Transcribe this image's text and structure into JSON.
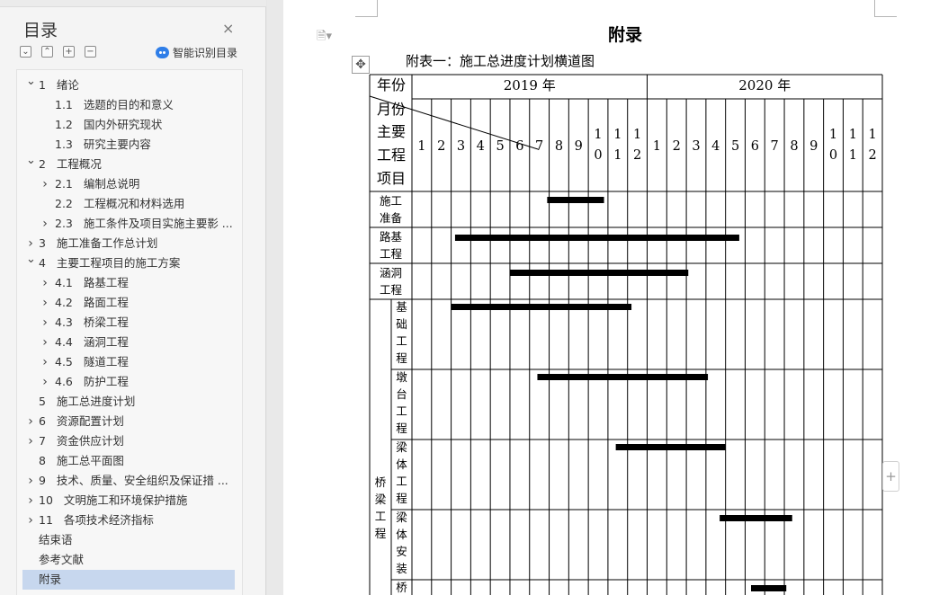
{
  "sidebar": {
    "title": "目录",
    "close_glyph": "×",
    "tools": [
      {
        "icon": "collapse-all-icon",
        "glyph": "⌄"
      },
      {
        "icon": "expand-all-icon",
        "glyph": "⌃"
      },
      {
        "icon": "add-heading-icon",
        "glyph": "+"
      },
      {
        "icon": "remove-heading-icon",
        "glyph": "−"
      }
    ],
    "smart_label": "智能识别目录",
    "items": [
      {
        "level": 0,
        "chevron": "down",
        "num": "1",
        "label": "绪论"
      },
      {
        "level": 1,
        "chevron": "",
        "num": "1.1",
        "label": "选题的目的和意义"
      },
      {
        "level": 1,
        "chevron": "",
        "num": "1.2",
        "label": "国内外研究现状"
      },
      {
        "level": 1,
        "chevron": "",
        "num": "1.3",
        "label": "研究主要内容"
      },
      {
        "level": 0,
        "chevron": "down",
        "num": "2",
        "label": "工程概况"
      },
      {
        "level": 1,
        "chevron": "right",
        "num": "2.1",
        "label": "编制总说明"
      },
      {
        "level": 1,
        "chevron": "",
        "num": "2.2",
        "label": "工程概况和材料选用"
      },
      {
        "level": 1,
        "chevron": "right",
        "num": "2.3",
        "label": "施工条件及项目实施主要影 ..."
      },
      {
        "level": 0,
        "chevron": "right",
        "num": "3",
        "label": "施工准备工作总计划"
      },
      {
        "level": 0,
        "chevron": "down",
        "num": "4",
        "label": "主要工程项目的施工方案"
      },
      {
        "level": 1,
        "chevron": "right",
        "num": "4.1",
        "label": "路基工程"
      },
      {
        "level": 1,
        "chevron": "right",
        "num": "4.2",
        "label": "路面工程"
      },
      {
        "level": 1,
        "chevron": "right",
        "num": "4.3",
        "label": "桥梁工程"
      },
      {
        "level": 1,
        "chevron": "right",
        "num": "4.4",
        "label": "涵洞工程"
      },
      {
        "level": 1,
        "chevron": "right",
        "num": "4.5",
        "label": "隧道工程"
      },
      {
        "level": 1,
        "chevron": "right",
        "num": "4.6",
        "label": "防护工程"
      },
      {
        "level": 0,
        "chevron": "",
        "num": "5",
        "label": "施工总进度计划"
      },
      {
        "level": 0,
        "chevron": "right",
        "num": "6",
        "label": "资源配置计划"
      },
      {
        "level": 0,
        "chevron": "right",
        "num": "7",
        "label": "资金供应计划"
      },
      {
        "level": 0,
        "chevron": "",
        "num": "8",
        "label": "施工总平面图"
      },
      {
        "level": 0,
        "chevron": "right",
        "num": "9",
        "label": "技术、质量、安全组织及保证措 ..."
      },
      {
        "level": 0,
        "chevron": "right",
        "num": "10",
        "label": "文明施工和环境保护措施"
      },
      {
        "level": 0,
        "chevron": "right",
        "num": "11",
        "label": "各项技术经济指标"
      },
      {
        "level": 0,
        "chevron": "",
        "num": "",
        "label": "结束语"
      },
      {
        "level": 0,
        "chevron": "",
        "num": "",
        "label": "参考文献"
      },
      {
        "level": 0,
        "chevron": "",
        "num": "",
        "label": "附录",
        "selected": true
      }
    ]
  },
  "document": {
    "page_icon": "document-icon",
    "title": "附录",
    "caption": "附表一：施工总进度计划横道图",
    "move_handle_glyph": "✥",
    "add_glyph": "+"
  },
  "table": {
    "header_year_label": "年份",
    "header_month_label": "月份",
    "header_main_label": [
      "主要",
      "工程",
      "项目"
    ],
    "years": [
      "2019 年",
      "2020 年"
    ],
    "months": [
      "1",
      "2",
      "3",
      "4",
      "5",
      "6",
      "7",
      "8",
      "9",
      "10",
      "11",
      "12",
      "1",
      "2",
      "3",
      "4",
      "5",
      "6",
      "7",
      "8",
      "9",
      "10",
      "11",
      "12"
    ],
    "rows": [
      {
        "label": [
          "施工",
          "准备"
        ],
        "group": "",
        "bars": [
          {
            "start": 7.9,
            "end": 10.8
          }
        ]
      },
      {
        "label": [
          "路基",
          "工程"
        ],
        "group": "",
        "bars": [
          {
            "start": 3.2,
            "end": 17.7
          }
        ]
      },
      {
        "label": [
          "涵洞",
          "工程"
        ],
        "group": "",
        "bars": [
          {
            "start": 6.0,
            "end": 15.1
          }
        ]
      },
      {
        "label": [
          "基",
          "础",
          "工",
          "程"
        ],
        "group": "桥梁工程",
        "bars": [
          {
            "start": 3.0,
            "end": 12.2
          }
        ]
      },
      {
        "label": [
          "墩",
          "台",
          "工",
          "程"
        ],
        "group": "桥梁工程",
        "bars": [
          {
            "start": 7.4,
            "end": 16.1
          }
        ]
      },
      {
        "label": [
          "梁",
          "体",
          "工",
          "程"
        ],
        "group": "桥梁工程",
        "bars": [
          {
            "start": 11.4,
            "end": 17.0
          }
        ]
      },
      {
        "label": [
          "梁",
          "体",
          "安",
          "装"
        ],
        "group": "桥梁工程",
        "bars": [
          {
            "start": 16.7,
            "end": 20.4
          }
        ]
      },
      {
        "label": [
          "桥"
        ],
        "group": "桥梁工程",
        "bars": [
          {
            "start": 18.3,
            "end": 20.1
          }
        ]
      }
    ],
    "group_label": [
      "桥",
      "梁",
      "工",
      "程"
    ]
  }
}
